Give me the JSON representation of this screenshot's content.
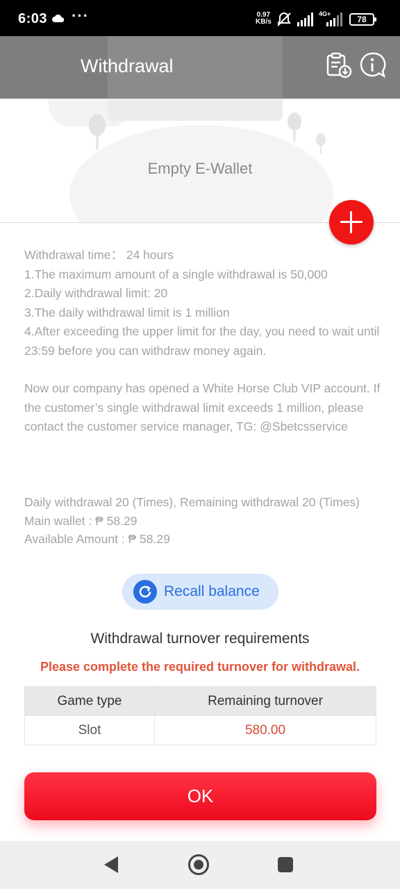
{
  "status_bar": {
    "time": "6:03",
    "dots": "···",
    "net_speed_value": "0.97",
    "net_speed_unit": "KB/s",
    "network": "4G+",
    "battery": "78"
  },
  "header": {
    "title": "Withdrawal",
    "records_icon": "clipboard-download-icon",
    "info_icon": "info-bubble-icon"
  },
  "wallet": {
    "empty_text": "Empty E-Wallet",
    "add_icon": "plus-icon"
  },
  "info": {
    "lines": [
      "Withdrawal time： 24 hours",
      "1.The maximum amount of a single withdrawal is 50,000",
      "2.Daily withdrawal limit: 20",
      "3.The daily withdrawal limit is 1 million",
      "4.After exceeding the upper limit for the day, you need to wait until 23:59 before you can withdraw money again."
    ],
    "vip_notice": "Now our company has opened a White Horse Club VIP account. If the customer’s single withdrawal limit exceeds 1 million, please contact the customer service manager, TG: @Sbetcsservice"
  },
  "balance": {
    "daily_withdrawal": "Daily withdrawal 20 (Times), Remaining withdrawal 20 (Times)",
    "main_wallet": "Main wallet : ₱ 58.29",
    "available_amount": "Available Amount : ₱ 58.29",
    "recall_label": "Recall balance"
  },
  "turnover": {
    "title": "Withdrawal turnover requirements",
    "warning": "Please complete the required turnover for withdrawal.",
    "headers": [
      "Game type",
      "Remaining turnover"
    ],
    "rows": [
      {
        "game_type": "Slot",
        "remaining": "580.00"
      }
    ]
  },
  "ok_label": "OK",
  "colors": {
    "accent_red": "#f01616",
    "warning_red": "#e2543a",
    "recall_blue": "#2a6fe0"
  }
}
